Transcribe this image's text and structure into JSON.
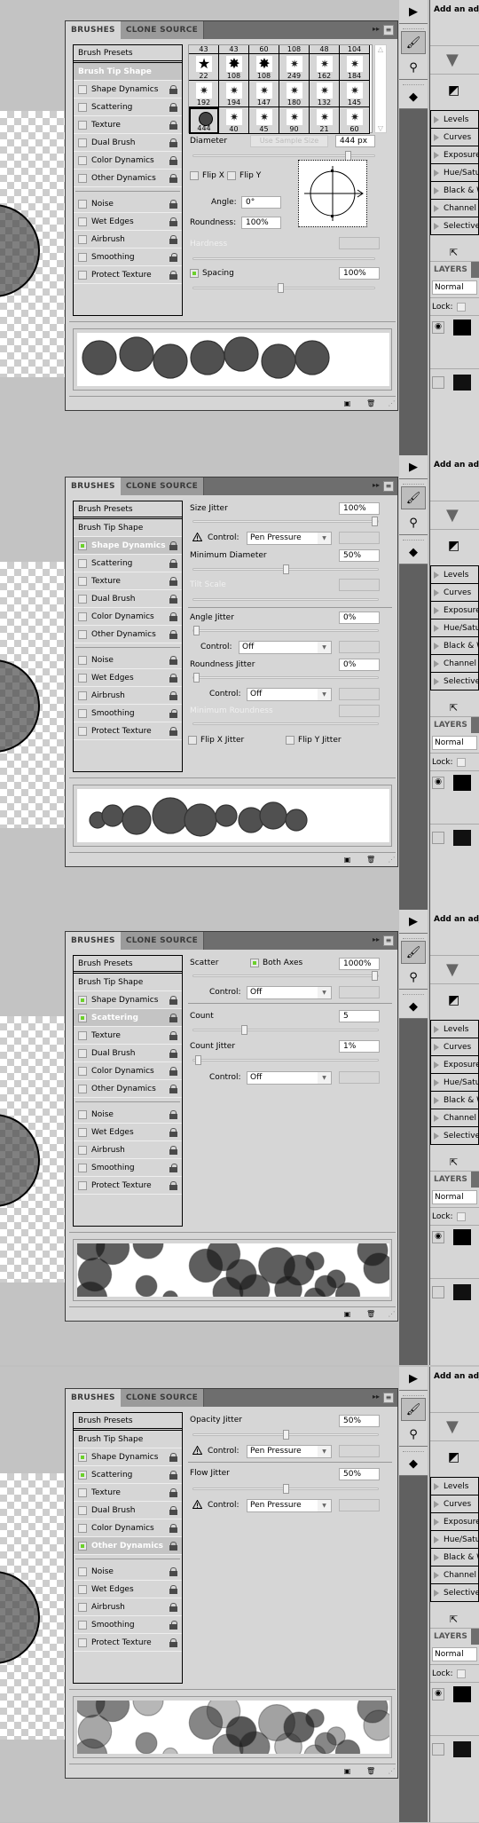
{
  "panel": {
    "tabs": [
      "BRUSHES",
      "CLONE SOURCE"
    ],
    "collapse_icon": "double-arrow-icon",
    "menu_icon": "panel-menu-icon",
    "brush_presets_label": "Brush Presets",
    "options": [
      {
        "label": "Brush Tip Shape",
        "lockable": false
      },
      {
        "label": "Shape Dynamics",
        "lockable": true
      },
      {
        "label": "Scattering",
        "lockable": true
      },
      {
        "label": "Texture",
        "lockable": true
      },
      {
        "label": "Dual Brush",
        "lockable": true
      },
      {
        "label": "Color Dynamics",
        "lockable": true
      },
      {
        "label": "Other Dynamics",
        "lockable": true
      },
      {
        "label": "Noise",
        "lockable": true
      },
      {
        "label": "Wet Edges",
        "lockable": true
      },
      {
        "label": "Airbrush",
        "lockable": true
      },
      {
        "label": "Smoothing",
        "lockable": true,
        "locked": true
      },
      {
        "label": "Protect Texture",
        "lockable": true
      }
    ],
    "bottom_icons": [
      "new-preset-icon",
      "trash-icon"
    ]
  },
  "screens": [
    {
      "selected_option": "Brush Tip Shape",
      "checked": [
        "Spacing"
      ],
      "brush_tip": {
        "grid_labels": [
          [
            "43",
            "43",
            "60",
            "108",
            "48",
            "104"
          ],
          [
            "22",
            "108",
            "108",
            "249",
            "162",
            "184"
          ],
          [
            "192",
            "194",
            "147",
            "180",
            "132",
            "145"
          ],
          [
            "444",
            "40",
            "45",
            "90",
            "21",
            "60"
          ]
        ],
        "selected_brush": "444",
        "diameter_label": "Diameter",
        "use_sample_size": "Use Sample Size",
        "diameter_value": "444 px",
        "diameter_slider": 0.87,
        "flip_x": "Flip X",
        "flip_y": "Flip Y",
        "angle_label": "Angle:",
        "angle_value": "0°",
        "roundness_label": "Roundness:",
        "roundness_value": "100%",
        "hardness_label": "Hardness",
        "spacing_label": "Spacing",
        "spacing_value": "100%",
        "spacing_slider": 0.48
      }
    },
    {
      "selected_option": "Shape Dynamics",
      "checked": [
        "Shape Dynamics"
      ],
      "shape": {
        "size_jitter_label": "Size Jitter",
        "size_jitter_value": "100%",
        "size_jitter_slider": 1.0,
        "control_label": "Control:",
        "size_control": "Pen Pressure",
        "min_diameter_label": "Minimum Diameter",
        "min_diameter_value": "50%",
        "min_diameter_slider": 0.5,
        "tilt_scale_label": "Tilt Scale",
        "angle_jitter_label": "Angle Jitter",
        "angle_jitter_value": "0%",
        "angle_jitter_slider": 0,
        "angle_control": "Off",
        "roundness_jitter_label": "Roundness Jitter",
        "roundness_jitter_value": "0%",
        "roundness_jitter_slider": 0,
        "roundness_control": "Off",
        "min_roundness_label": "Minimum Roundness",
        "flip_x_jitter": "Flip X Jitter",
        "flip_y_jitter": "Flip Y Jitter"
      }
    },
    {
      "selected_option": "Scattering",
      "checked": [
        "Shape Dynamics",
        "Scattering",
        "Both Axes"
      ],
      "scatter": {
        "scatter_label": "Scatter",
        "both_axes_label": "Both Axes",
        "scatter_value": "1000%",
        "scatter_slider": 1.0,
        "control_label": "Control:",
        "scatter_control": "Off",
        "count_label": "Count",
        "count_value": "5",
        "count_slider": 0.27,
        "count_jitter_label": "Count Jitter",
        "count_jitter_value": "1%",
        "count_jitter_slider": 0.01,
        "count_control": "Off"
      }
    },
    {
      "selected_option": "Other Dynamics",
      "checked": [
        "Shape Dynamics",
        "Scattering",
        "Other Dynamics"
      ],
      "other": {
        "opacity_jitter_label": "Opacity Jitter",
        "opacity_jitter_value": "50%",
        "opacity_jitter_slider": 0.5,
        "control_label": "Control:",
        "opacity_control": "Pen Pressure",
        "flow_jitter_label": "Flow Jitter",
        "flow_jitter_value": "50%",
        "flow_jitter_slider": 0.5,
        "flow_control": "Pen Pressure"
      }
    }
  ],
  "sidepanel": {
    "adjustments_title": "Add an adjustment",
    "adjustments": [
      "Levels",
      "Curves",
      "Exposure",
      "Hue/Saturation",
      "Black & White",
      "Channel Mixer",
      "Selective Color"
    ],
    "layers_tab": "LAYERS",
    "blend_mode": "Normal",
    "lock_label": "Lock:"
  },
  "colors": {
    "panel_bg": "#d6d6d6",
    "tab_bar": "#6e6e6e",
    "check_green": "#6bd12a",
    "tool_dark": "#606060"
  }
}
